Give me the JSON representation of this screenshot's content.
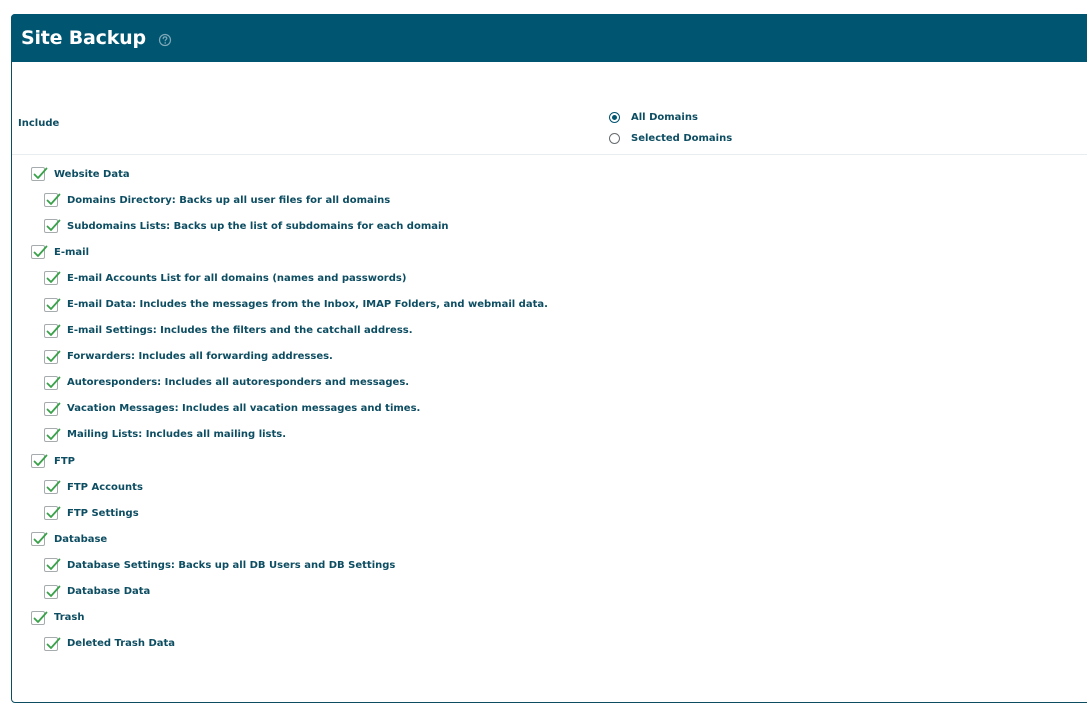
{
  "header": {
    "title": "Site Backup"
  },
  "include": {
    "label": "Include",
    "options": [
      {
        "label": "All Domains",
        "checked": true
      },
      {
        "label": "Selected Domains",
        "checked": false
      }
    ]
  },
  "groups": [
    {
      "label": "Website Data",
      "checked": true,
      "items": [
        {
          "label": "Domains Directory: Backs up all user files for all domains",
          "checked": true
        },
        {
          "label": "Subdomains Lists: Backs up the list of subdomains for each domain",
          "checked": true
        }
      ]
    },
    {
      "label": "E-mail",
      "checked": true,
      "items": [
        {
          "label": "E-mail Accounts List for all domains (names and passwords)",
          "checked": true
        },
        {
          "label": "E-mail Data: Includes the messages from the Inbox, IMAP Folders, and webmail data.",
          "checked": true
        },
        {
          "label": "E-mail Settings: Includes the filters and the catchall address.",
          "checked": true
        },
        {
          "label": "Forwarders: Includes all forwarding addresses.",
          "checked": true
        },
        {
          "label": "Autoresponders: Includes all autoresponders and messages.",
          "checked": true
        },
        {
          "label": "Vacation Messages: Includes all vacation messages and times.",
          "checked": true
        },
        {
          "label": "Mailing Lists: Includes all mailing lists.",
          "checked": true
        }
      ]
    },
    {
      "label": "FTP",
      "checked": true,
      "items": [
        {
          "label": "FTP Accounts",
          "checked": true
        },
        {
          "label": "FTP Settings",
          "checked": true
        }
      ]
    },
    {
      "label": "Database",
      "checked": true,
      "items": [
        {
          "label": "Database Settings: Backs up all DB Users and DB Settings",
          "checked": true
        },
        {
          "label": "Database Data",
          "checked": true
        }
      ]
    },
    {
      "label": "Trash",
      "checked": true,
      "items": [
        {
          "label": "Deleted Trash Data",
          "checked": true
        }
      ]
    }
  ],
  "colors": {
    "header_bg": "#005571",
    "text": "#0d4d62",
    "check": "#3aa14a"
  }
}
